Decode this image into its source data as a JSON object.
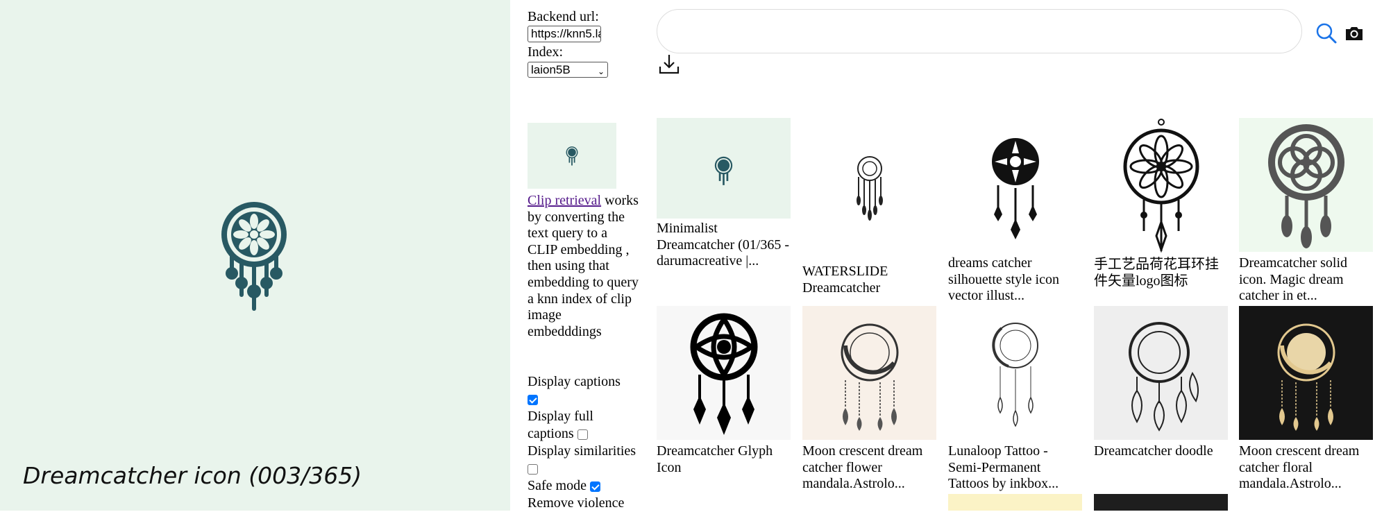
{
  "left": {
    "caption": "Dreamcatcher icon (003/365)"
  },
  "controls": {
    "backend_label": "Backend url:",
    "backend_value": "https://knn5.la",
    "index_label": "Index:",
    "index_value": "laion5B"
  },
  "search": {
    "placeholder": ""
  },
  "info": {
    "link": "Clip retrieval",
    "text": "works by converting the text query to a CLIP embedding , then using that embedding to query a knn index of clip image embedddings"
  },
  "options": [
    {
      "label": "Display captions",
      "checked": true
    },
    {
      "label": "Display full captions",
      "checked": false
    },
    {
      "label": "Display similarities",
      "checked": false
    },
    {
      "label": "Safe mode",
      "checked": true
    },
    {
      "label": "Remove violence",
      "checked": null
    }
  ],
  "results": [
    {
      "caption": "Minimalist Dreamcatcher (01/365 - darumacreative |...",
      "bg": "#e9f4ec"
    },
    {
      "caption": "WATERSLIDE Dreamcatcher",
      "bg": "#ffffff"
    },
    {
      "caption": "dreams catcher silhouette style icon vector illust...",
      "bg": "#ffffff"
    },
    {
      "caption": "手工艺品荷花耳环挂件矢量logo图标",
      "bg": "#ffffff"
    },
    {
      "caption": "Dreamcatcher solid icon. Magic dream catcher in et...",
      "bg": "#eef9ee"
    },
    {
      "caption": "Dreamcatcher Glyph Icon",
      "bg": "#f4f4f4"
    },
    {
      "caption": "Moon crescent dream catcher flower mandala.Astrolo...",
      "bg": "#f8f0e8"
    },
    {
      "caption": "Lunaloop Tattoo - Semi-Permanent Tattoos by inkbox...",
      "bg": "#ffffff"
    },
    {
      "caption": "Dreamcatcher doodle",
      "bg": "#eeeeee"
    },
    {
      "caption": "Moon crescent dream catcher floral mandala.Astrolo...",
      "bg": "#151515"
    }
  ],
  "colors": {
    "accent": "#0075ff",
    "icon_teal": "#285963",
    "link": "#551a8b"
  }
}
